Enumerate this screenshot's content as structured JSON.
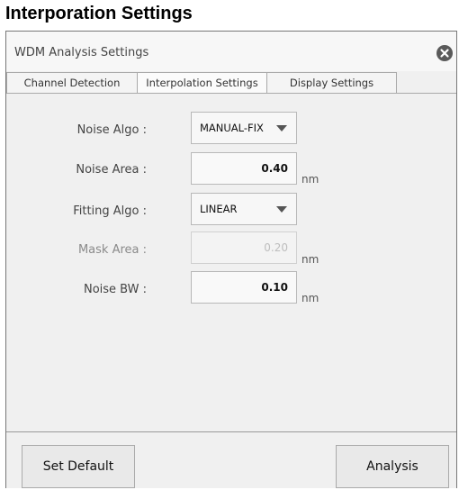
{
  "heading": "Interporation Settings",
  "dialog": {
    "title": "WDM Analysis Settings",
    "close_icon": "close-icon"
  },
  "tabs": [
    {
      "label": "Channel Detection",
      "active": false
    },
    {
      "label": "Interpolation Settings",
      "active": true
    },
    {
      "label": "Display Settings",
      "active": false
    }
  ],
  "settings": {
    "noise_algo": {
      "label": "Noise Algo :",
      "value": "MANUAL-FIX"
    },
    "noise_area": {
      "label": "Noise Area :",
      "value": "0.40",
      "unit": "nm"
    },
    "fitting_algo": {
      "label": "Fitting Algo :",
      "value": "LINEAR"
    },
    "mask_area": {
      "label": "Mask Area :",
      "value": "0.20",
      "unit": "nm",
      "enabled": false
    },
    "noise_bw": {
      "label": "Noise BW :",
      "value": "0.10",
      "unit": "nm"
    }
  },
  "buttons": {
    "set_default": "Set Default",
    "analysis": "Analysis"
  },
  "colors": {
    "dialog_bg": "#f0f0f0",
    "border": "#777777",
    "close_bg": "#5a5a5a"
  }
}
